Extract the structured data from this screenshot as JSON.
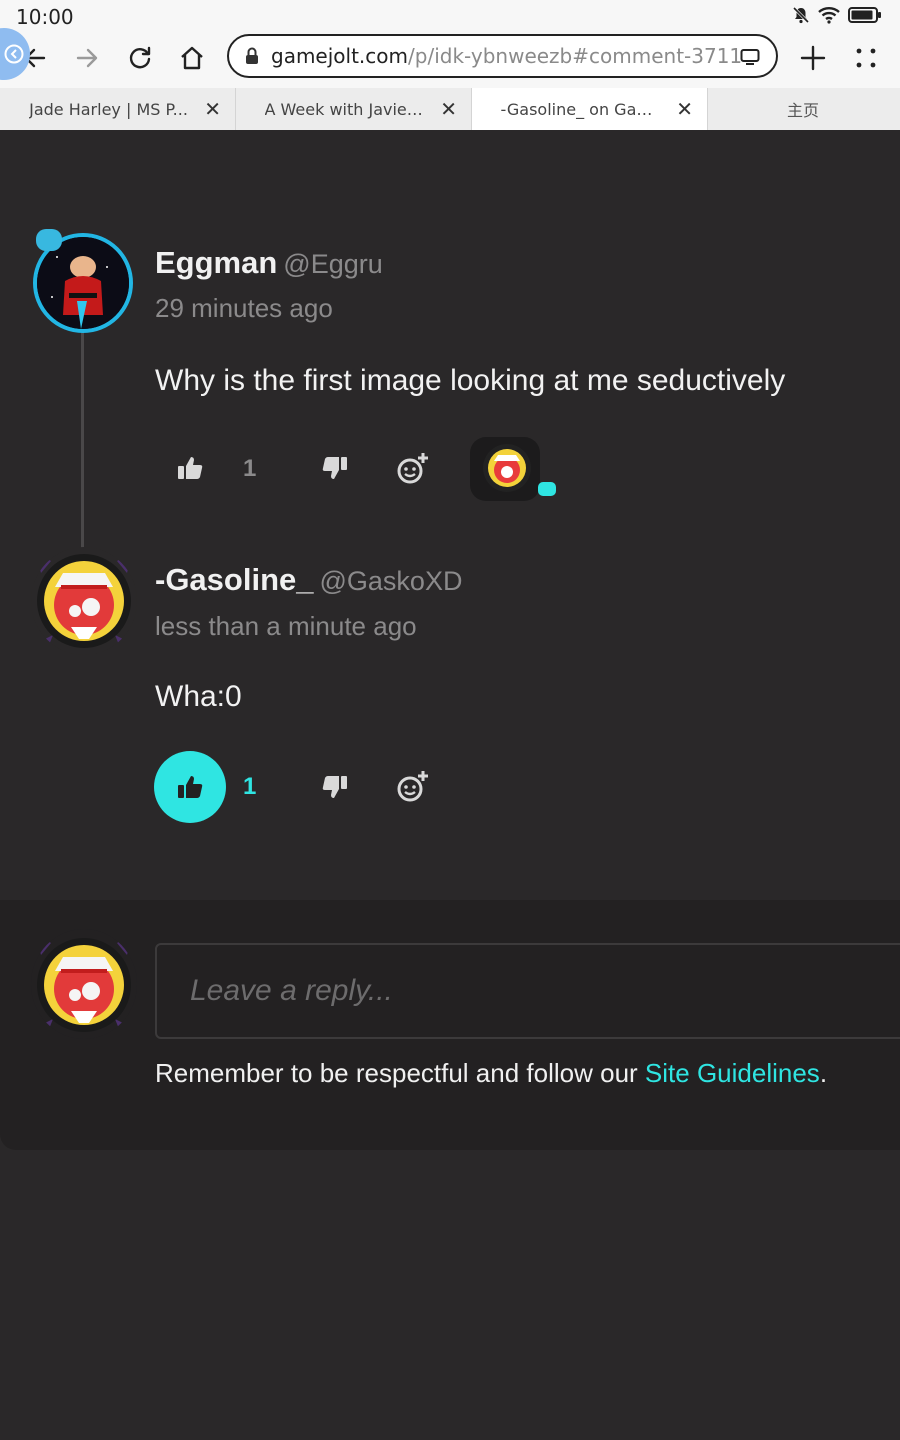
{
  "status_bar": {
    "time": "10:00"
  },
  "browser": {
    "url": {
      "domain": "gamejolt.com",
      "path": "/p/idk-ybnweezb#comment-3711"
    },
    "tabs": [
      {
        "title": "Jade Harley | MS P..."
      },
      {
        "title": "A Week with Javier..."
      },
      {
        "title": "-Gasoline_ on Gam..."
      }
    ],
    "home_tab": "主页"
  },
  "comments": [
    {
      "display_name": "Eggman",
      "handle": "@Eggru",
      "time": "29 minutes ago",
      "text": "Why is the first image looking at me seductively",
      "likes": "1",
      "liked": false
    },
    {
      "display_name": "-Gasoline_",
      "handle": "@GaskoXD",
      "time": "less than a minute ago",
      "text": "Wha:0",
      "likes": "1",
      "liked": true
    }
  ],
  "reply": {
    "placeholder": "Leave a reply...",
    "guideline_prefix": "Remember to be respectful and follow our ",
    "guideline_link": "Site Guidelines",
    "guideline_suffix": "."
  },
  "colors": {
    "accent": "#2fe5e2",
    "background": "#2a2829"
  }
}
